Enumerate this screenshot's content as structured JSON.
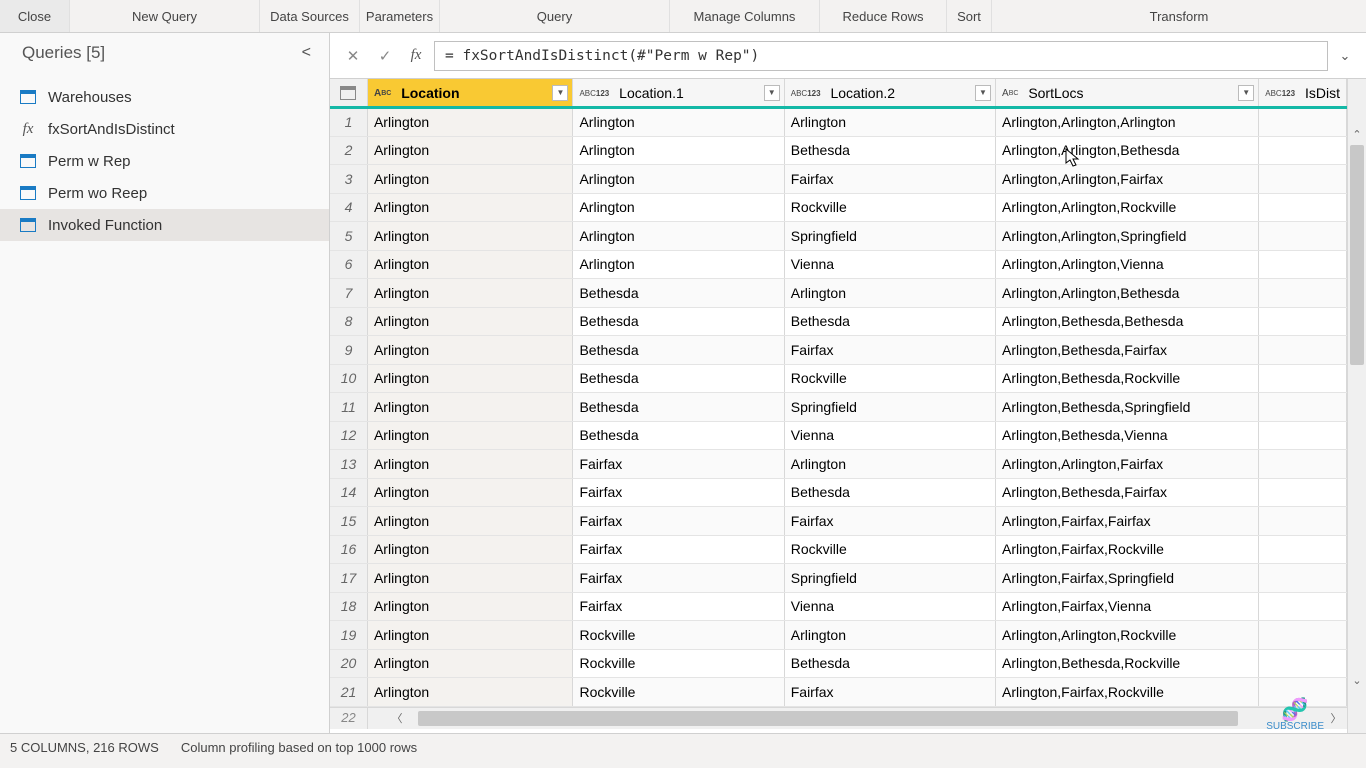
{
  "ribbon": {
    "close": "Close",
    "newquery": "New Query",
    "datasources": "Data Sources",
    "parameters": "Parameters",
    "query": "Query",
    "managecols": "Manage Columns",
    "reducerows": "Reduce Rows",
    "sort": "Sort",
    "transform": "Transform"
  },
  "queries": {
    "header": "Queries [5]",
    "items": [
      {
        "label": "Warehouses",
        "icon": "table"
      },
      {
        "label": "fxSortAndIsDistinct",
        "icon": "fx"
      },
      {
        "label": "Perm w Rep",
        "icon": "table"
      },
      {
        "label": "Perm wo Reep",
        "icon": "table"
      },
      {
        "label": "Invoked Function",
        "icon": "table"
      }
    ]
  },
  "formula": "= fxSortAndIsDistinct(#\"Perm w Rep\")",
  "columns": {
    "location": "Location",
    "location1": "Location.1",
    "location2": "Location.2",
    "sortlocs": "SortLocs",
    "isdist": "IsDist"
  },
  "rows": [
    {
      "n": "1",
      "loc": "Arlington",
      "loc1": "Arlington",
      "loc2": "Arlington",
      "sort": "Arlington,Arlington,Arlington"
    },
    {
      "n": "2",
      "loc": "Arlington",
      "loc1": "Arlington",
      "loc2": "Bethesda",
      "sort": "Arlington,Arlington,Bethesda"
    },
    {
      "n": "3",
      "loc": "Arlington",
      "loc1": "Arlington",
      "loc2": "Fairfax",
      "sort": "Arlington,Arlington,Fairfax"
    },
    {
      "n": "4",
      "loc": "Arlington",
      "loc1": "Arlington",
      "loc2": "Rockville",
      "sort": "Arlington,Arlington,Rockville"
    },
    {
      "n": "5",
      "loc": "Arlington",
      "loc1": "Arlington",
      "loc2": "Springfield",
      "sort": "Arlington,Arlington,Springfield"
    },
    {
      "n": "6",
      "loc": "Arlington",
      "loc1": "Arlington",
      "loc2": "Vienna",
      "sort": "Arlington,Arlington,Vienna"
    },
    {
      "n": "7",
      "loc": "Arlington",
      "loc1": "Bethesda",
      "loc2": "Arlington",
      "sort": "Arlington,Arlington,Bethesda"
    },
    {
      "n": "8",
      "loc": "Arlington",
      "loc1": "Bethesda",
      "loc2": "Bethesda",
      "sort": "Arlington,Bethesda,Bethesda"
    },
    {
      "n": "9",
      "loc": "Arlington",
      "loc1": "Bethesda",
      "loc2": "Fairfax",
      "sort": "Arlington,Bethesda,Fairfax"
    },
    {
      "n": "10",
      "loc": "Arlington",
      "loc1": "Bethesda",
      "loc2": "Rockville",
      "sort": "Arlington,Bethesda,Rockville"
    },
    {
      "n": "11",
      "loc": "Arlington",
      "loc1": "Bethesda",
      "loc2": "Springfield",
      "sort": "Arlington,Bethesda,Springfield"
    },
    {
      "n": "12",
      "loc": "Arlington",
      "loc1": "Bethesda",
      "loc2": "Vienna",
      "sort": "Arlington,Bethesda,Vienna"
    },
    {
      "n": "13",
      "loc": "Arlington",
      "loc1": "Fairfax",
      "loc2": "Arlington",
      "sort": "Arlington,Arlington,Fairfax"
    },
    {
      "n": "14",
      "loc": "Arlington",
      "loc1": "Fairfax",
      "loc2": "Bethesda",
      "sort": "Arlington,Bethesda,Fairfax"
    },
    {
      "n": "15",
      "loc": "Arlington",
      "loc1": "Fairfax",
      "loc2": "Fairfax",
      "sort": "Arlington,Fairfax,Fairfax"
    },
    {
      "n": "16",
      "loc": "Arlington",
      "loc1": "Fairfax",
      "loc2": "Rockville",
      "sort": "Arlington,Fairfax,Rockville"
    },
    {
      "n": "17",
      "loc": "Arlington",
      "loc1": "Fairfax",
      "loc2": "Springfield",
      "sort": "Arlington,Fairfax,Springfield"
    },
    {
      "n": "18",
      "loc": "Arlington",
      "loc1": "Fairfax",
      "loc2": "Vienna",
      "sort": "Arlington,Fairfax,Vienna"
    },
    {
      "n": "19",
      "loc": "Arlington",
      "loc1": "Rockville",
      "loc2": "Arlington",
      "sort": "Arlington,Arlington,Rockville"
    },
    {
      "n": "20",
      "loc": "Arlington",
      "loc1": "Rockville",
      "loc2": "Bethesda",
      "sort": "Arlington,Bethesda,Rockville"
    },
    {
      "n": "21",
      "loc": "Arlington",
      "loc1": "Rockville",
      "loc2": "Fairfax",
      "sort": "Arlington,Fairfax,Rockville"
    }
  ],
  "partial_row": "22",
  "status": {
    "cols_rows": "5 COLUMNS, 216 ROWS",
    "profiling": "Column profiling based on top 1000 rows"
  },
  "watermark": "SUBSCRIBE"
}
